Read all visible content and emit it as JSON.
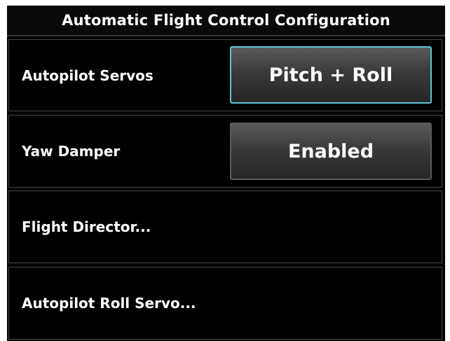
{
  "title": "Automatic Flight Control Configuration",
  "rows": [
    {
      "label": "Autopilot Servos",
      "value": "Pitch + Roll",
      "selected": true
    },
    {
      "label": "Yaw Damper",
      "value": "Enabled",
      "selected": false
    },
    {
      "label": "Flight Director..."
    },
    {
      "label": "Autopilot Roll Servo..."
    }
  ],
  "colors": {
    "background": "#000000",
    "text": "#ffffff",
    "button_top": "#5a5a5a",
    "button_bottom": "#262626",
    "selection_border": "#5fc3d6",
    "row_border": "#4a4a4a"
  }
}
